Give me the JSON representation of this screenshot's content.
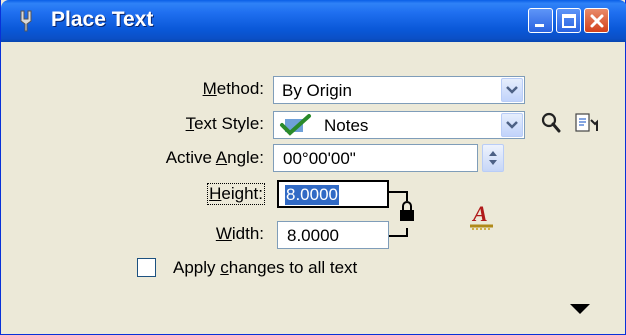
{
  "window": {
    "title": "Place Text"
  },
  "form": {
    "method": {
      "label_u": "M",
      "label_rest": "ethod:",
      "value": "By Origin"
    },
    "text_style": {
      "label_u": "T",
      "label_rest": "ext Style:",
      "value": "Notes"
    },
    "active_angle": {
      "label_pre": "Active ",
      "label_u": "A",
      "label_rest": "ngle:",
      "value": "00°00'00\""
    },
    "height": {
      "label_u": "H",
      "label_rest": "eight:",
      "value": "8.0000"
    },
    "width": {
      "label_u": "W",
      "label_rest": "idth:",
      "value": "8.0000"
    },
    "apply_all": {
      "label_pre": "Apply ",
      "label_u": "c",
      "label_rest": "hanges to all text",
      "checked": false
    }
  },
  "icons": [
    "tool-icon",
    "minimize-icon",
    "maximize-icon",
    "close-icon",
    "dropdown-arrow-icon",
    "checkmark-icon",
    "magnifier-icon",
    "match-text-icon",
    "spin-arrows-icon",
    "lock-icon",
    "text-attributes-icon",
    "expand-arrow-icon"
  ],
  "colors": {
    "titlebar": "#0a58d8",
    "face": "#ece9d8",
    "selection": "#316ac5"
  }
}
